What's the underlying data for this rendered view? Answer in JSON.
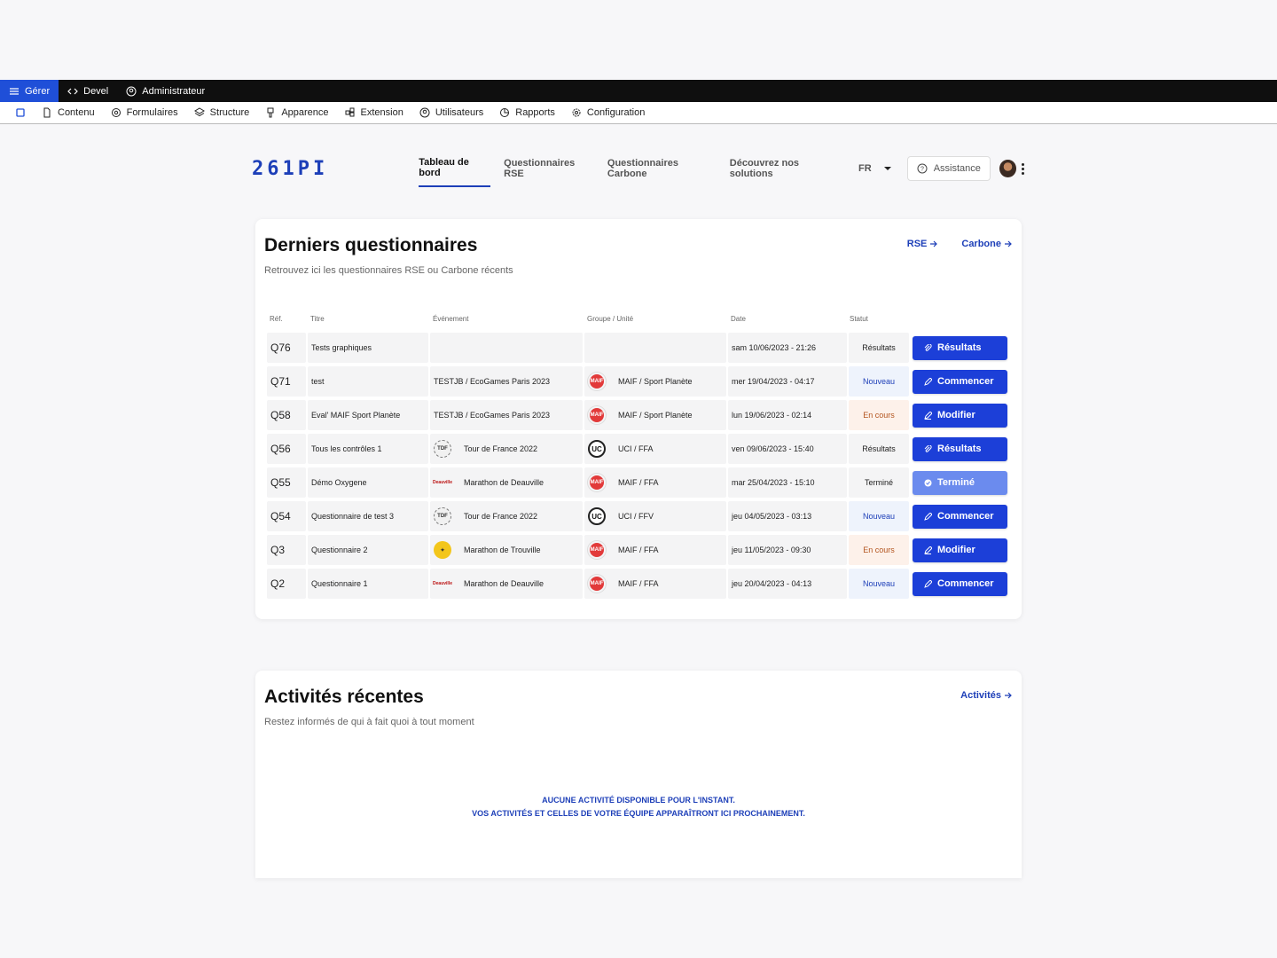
{
  "admin_bar": {
    "items": [
      {
        "label": "Gérer"
      },
      {
        "label": "Devel"
      },
      {
        "label": "Administrateur"
      }
    ]
  },
  "tray": {
    "items": [
      {
        "label": "Contenu"
      },
      {
        "label": "Formulaires"
      },
      {
        "label": "Structure"
      },
      {
        "label": "Apparence"
      },
      {
        "label": "Extension"
      },
      {
        "label": "Utilisateurs"
      },
      {
        "label": "Rapports"
      },
      {
        "label": "Configuration"
      }
    ]
  },
  "header": {
    "logo": "261PI",
    "nav": [
      {
        "label": "Tableau de bord"
      },
      {
        "label": "Questionnaires RSE"
      },
      {
        "label": "Questionnaires Carbone"
      },
      {
        "label": "Découvrez nos solutions"
      }
    ],
    "lang": "FR",
    "assist_label": "Assistance"
  },
  "questionnaires": {
    "title": "Derniers questionnaires",
    "subtitle": "Retrouvez ici les questionnaires RSE ou Carbone récents",
    "link_rse": "RSE",
    "link_carbone": "Carbone",
    "headers": {
      "ref": "Réf.",
      "title": "Titre",
      "event": "Événement",
      "group": "Groupe / Unité",
      "date": "Date",
      "status": "Statut"
    },
    "rows": [
      {
        "ref": "Q76",
        "title": "Tests graphiques",
        "event": "",
        "group": "",
        "date": "sam 10/06/2023 - 21:26",
        "status": "Résultats",
        "action": "Résultats"
      },
      {
        "ref": "Q71",
        "title": "test",
        "event": "TESTJB / EcoGames Paris 2023",
        "group": "MAIF / Sport Planète",
        "date": "mer 19/04/2023 - 04:17",
        "status": "Nouveau",
        "action": "Commencer"
      },
      {
        "ref": "Q58",
        "title": "Eval' MAIF Sport Planète",
        "event": "TESTJB / EcoGames Paris 2023",
        "group": "MAIF / Sport Planète",
        "date": "lun 19/06/2023 - 02:14",
        "status": "En cours",
        "action": "Modifier"
      },
      {
        "ref": "Q56",
        "title": "Tous les contrôles 1",
        "event": "Tour de France 2022",
        "group": "UCI / FFA",
        "date": "ven 09/06/2023 - 15:40",
        "status": "Résultats",
        "action": "Résultats"
      },
      {
        "ref": "Q55",
        "title": "Démo Oxygene",
        "event": "Marathon de Deauville",
        "group": "MAIF / FFA",
        "date": "mar 25/04/2023 - 15:10",
        "status": "Terminé",
        "action": "Terminé"
      },
      {
        "ref": "Q54",
        "title": "Questionnaire de test 3",
        "event": "Tour de France 2022",
        "group": "UCI / FFV",
        "date": "jeu 04/05/2023 - 03:13",
        "status": "Nouveau",
        "action": "Commencer"
      },
      {
        "ref": "Q3",
        "title": "Questionnaire 2",
        "event": "Marathon de Trouville",
        "group": "MAIF / FFA",
        "date": "jeu 11/05/2023 - 09:30",
        "status": "En cours",
        "action": "Modifier"
      },
      {
        "ref": "Q2",
        "title": "Questionnaire 1",
        "event": "Marathon de Deauville",
        "group": "MAIF / FFA",
        "date": "jeu 20/04/2023 - 04:13",
        "status": "Nouveau",
        "action": "Commencer"
      }
    ]
  },
  "activities": {
    "title": "Activités récentes",
    "subtitle": "Restez informés de qui à fait quoi à tout moment",
    "link": "Activités",
    "empty_line1": "AUCUNE ACTIVITÉ DISPONIBLE POUR L'INSTANT.",
    "empty_line2": "VOS ACTIVITÉS ET CELLES DE VOTRE ÉQUIPE APPARAÎTRONT ICI PROCHAINEMENT."
  },
  "colors": {
    "accent": "#1c3fd8",
    "brand": "#1d3fb8",
    "new_bg": "#eef3fc",
    "progress_text": "#b3541e"
  }
}
